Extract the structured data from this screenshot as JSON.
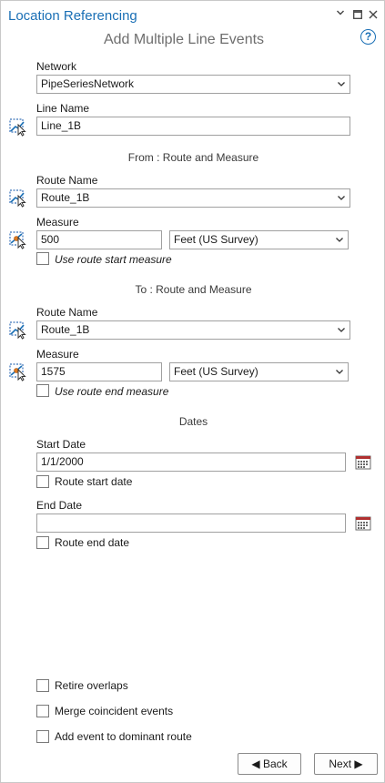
{
  "pane": {
    "title": "Location Referencing",
    "subtitle": "Add Multiple Line Events",
    "help_icon": "help-icon",
    "help_glyph": "?"
  },
  "network": {
    "label": "Network",
    "value": "PipeSeriesNetwork"
  },
  "line_name": {
    "label": "Line Name",
    "value": "Line_1B"
  },
  "from": {
    "heading": "From : Route and Measure",
    "route_label": "Route Name",
    "route_value": "Route_1B",
    "measure_label": "Measure",
    "measure_value": "500",
    "units_value": "Feet (US Survey)",
    "checkbox_label": "Use route start measure",
    "checked": false
  },
  "to": {
    "heading": "To : Route and Measure",
    "route_label": "Route Name",
    "route_value": "Route_1B",
    "measure_label": "Measure",
    "measure_value": "1575",
    "units_value": "Feet (US Survey)",
    "checkbox_label": "Use route end measure",
    "checked": false
  },
  "dates": {
    "heading": "Dates",
    "start_label": "Start Date",
    "start_value": "1/1/2000",
    "start_checkbox": "Route start date",
    "end_label": "End Date",
    "end_value": "",
    "end_checkbox": "Route end date"
  },
  "options": {
    "retire_overlaps": "Retire overlaps",
    "merge_coincident": "Merge coincident events",
    "dominant_route": "Add event to dominant route"
  },
  "buttons": {
    "back": "◀ Back",
    "next": "Next ▶"
  },
  "colors": {
    "accent": "#1a6fb5",
    "border": "#a0a0a0"
  }
}
